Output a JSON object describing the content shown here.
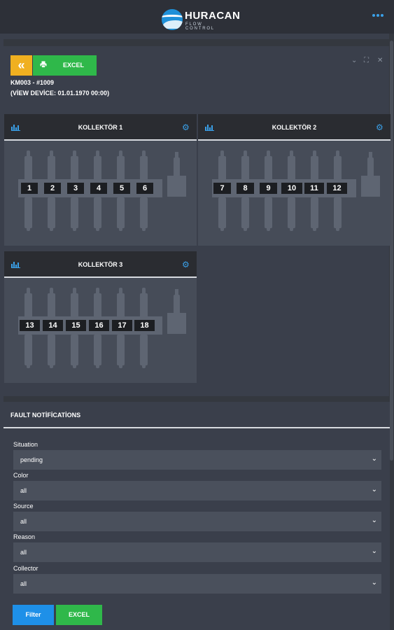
{
  "brand": {
    "name": "HURACAN",
    "tagline": "FLOW CONTROL"
  },
  "toolbar": {
    "back_symbol": "«",
    "excel_label": "EXCEL"
  },
  "window_icons": {
    "minimize": "⌄",
    "maximize": "⛶",
    "close": "✕"
  },
  "device": {
    "id_line": "KM003 - #1009",
    "view_line": "(VİEW DEVİCE: 01.01.1970 00:00)"
  },
  "collectors": [
    {
      "title": "KOLLEKTÖR 1",
      "valves": [
        "1",
        "2",
        "3",
        "4",
        "5",
        "6"
      ]
    },
    {
      "title": "KOLLEKTÖR 2",
      "valves": [
        "7",
        "8",
        "9",
        "10",
        "11",
        "12"
      ]
    },
    {
      "title": "KOLLEKTÖR 3",
      "valves": [
        "13",
        "14",
        "15",
        "16",
        "17",
        "18"
      ]
    }
  ],
  "fault": {
    "title": "FAULT NOTİFİCATİONS",
    "filters": [
      {
        "label": "Situation",
        "value": "pending"
      },
      {
        "label": "Color",
        "value": "all"
      },
      {
        "label": "Source",
        "value": "all"
      },
      {
        "label": "Reason",
        "value": "all"
      },
      {
        "label": "Collector",
        "value": "all"
      }
    ],
    "filter_button": "Filter",
    "excel_button": "EXCEL"
  },
  "colors": {
    "accent_blue": "#1e90e8",
    "excel_green": "#2fb84a",
    "back_yellow": "#f0b020"
  }
}
